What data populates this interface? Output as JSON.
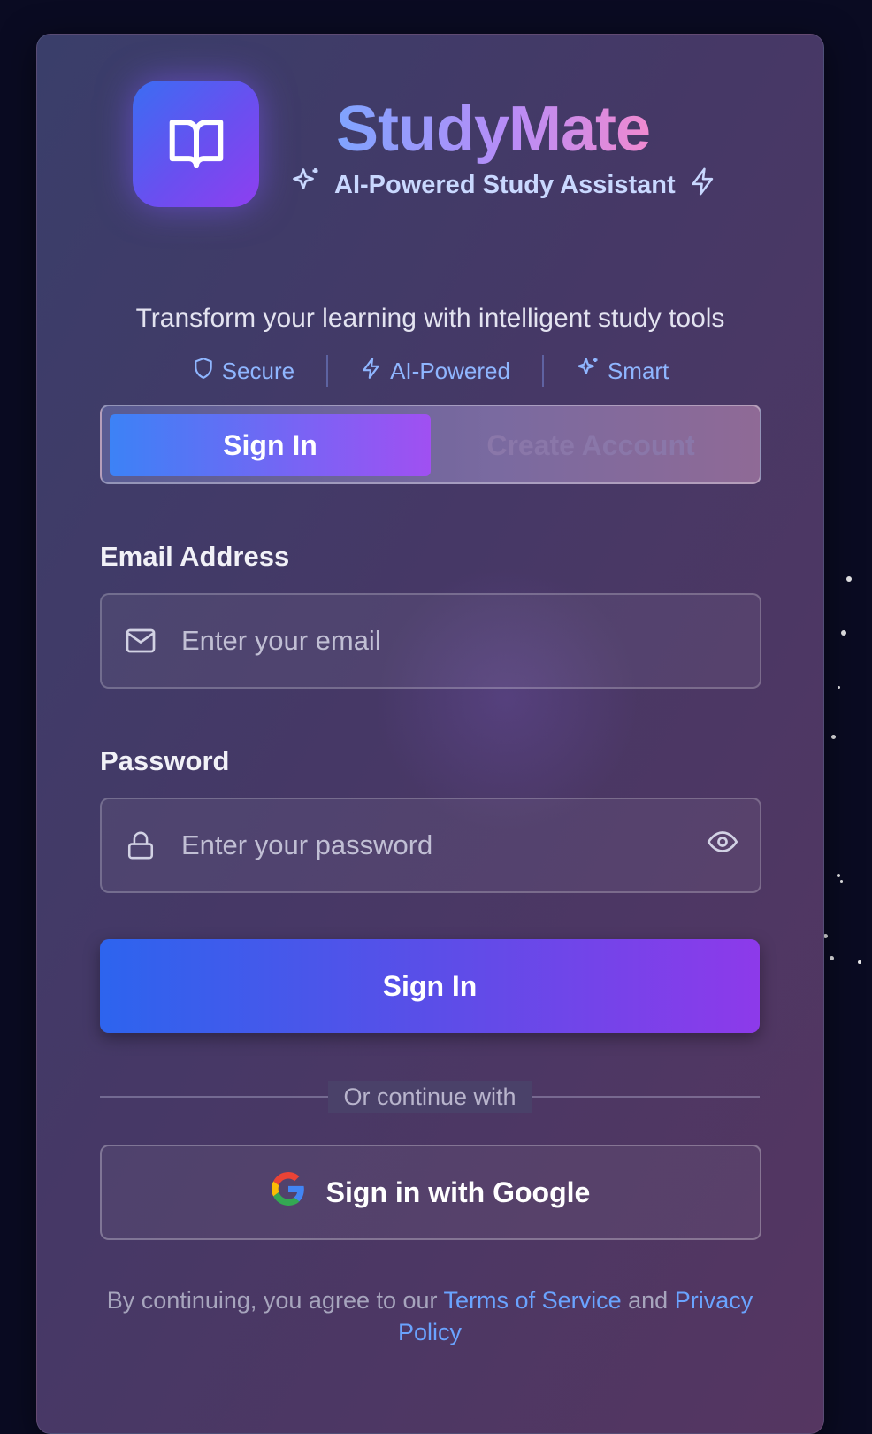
{
  "brand": {
    "name": "StudyMate",
    "subtitle": "AI-Powered Study Assistant"
  },
  "tagline": "Transform your learning with intelligent study tools",
  "features": [
    {
      "label": "Secure",
      "icon": "shield-icon"
    },
    {
      "label": "AI-Powered",
      "icon": "lightning-icon"
    },
    {
      "label": "Smart",
      "icon": "sparkles-icon"
    }
  ],
  "tabs": {
    "sign_in": "Sign In",
    "create_account": "Create Account",
    "active": "sign_in"
  },
  "form": {
    "email_label": "Email Address",
    "email_placeholder": "Enter your email",
    "password_label": "Password",
    "password_placeholder": "Enter your password",
    "submit_label": "Sign In"
  },
  "divider_text": "Or continue with",
  "google_button": "Sign in with Google",
  "legal": {
    "prefix": "By continuing, you agree to our",
    "terms": "Terms of Service",
    "and": "and",
    "privacy": "Privacy Policy"
  },
  "colors": {
    "background": "#0a0b22",
    "accent_blue": "#3c82f6",
    "accent_purple": "#9333ea",
    "link": "#6aa3ff"
  }
}
